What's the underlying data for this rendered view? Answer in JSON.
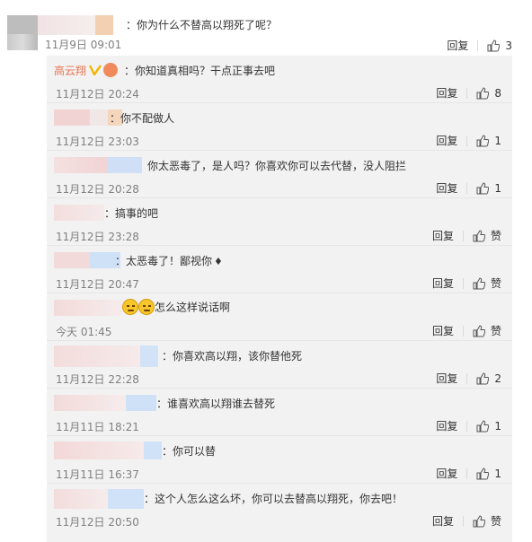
{
  "main_comment": {
    "text": "：你为什么不替高以翔死了呢？",
    "time": "11月9日 09:01",
    "reply_label": "回复",
    "like_count": "3"
  },
  "replies": [
    {
      "name": "高云翔",
      "text": "：你知道真相吗？干点正事去吧",
      "time": "11月12日 20:24",
      "reply_label": "回复",
      "like": "8"
    },
    {
      "text": "：你不配做人",
      "time": "11月12日 23:03",
      "reply_label": "回复",
      "like": "1"
    },
    {
      "text": "你太恶毒了，是人吗？你喜欢你可以去代替，没人阻拦",
      "time": "11月12日 20:28",
      "reply_label": "回复",
      "like": "1"
    },
    {
      "text": "：搞事的吧",
      "time": "11月12日 23:28",
      "reply_label": "回复",
      "like": "赞"
    },
    {
      "text": "：太恶毒了！鄙视你",
      "time": "11月12日 20:47",
      "reply_label": "回复",
      "like": "赞"
    },
    {
      "text": "怎么这样说话啊",
      "time": "今天 01:45",
      "reply_label": "回复",
      "like": "赞"
    },
    {
      "text": "：你喜欢高以翔，该你替他死",
      "time": "11月12日 22:28",
      "reply_label": "回复",
      "like": "2"
    },
    {
      "text": "：谁喜欢高以翔谁去替死",
      "time": "11月11日 18:21",
      "reply_label": "回复",
      "like": "1"
    },
    {
      "text": "：你可以替",
      "time": "11月11日 16:37",
      "reply_label": "回复",
      "like": "1"
    },
    {
      "text": "：这个人怎么这么坏，你可以去替高以翔死，你去吧！",
      "time": "11月12日 20:50",
      "reply_label": "回复",
      "like": "赞"
    }
  ],
  "icons": {
    "thumb": "thumbs-up-icon",
    "verified": "verified-v-icon",
    "point_down": "pointing-hand-icon"
  },
  "colors": {
    "name_orange": "#eb7350",
    "reply_bg": "#f2f2f2",
    "time_gray": "#808080"
  }
}
